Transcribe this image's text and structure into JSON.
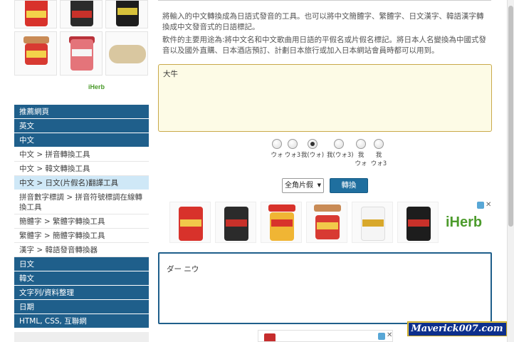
{
  "sidebar": {
    "iherb_label": "iHerb",
    "items": [
      {
        "label": "推薦網頁",
        "style": "dark"
      },
      {
        "label": "英文",
        "style": "dark"
      },
      {
        "label": "中文",
        "style": "dark"
      },
      {
        "label": "中文 > 拼音轉換工具",
        "style": "light"
      },
      {
        "label": "中文 > 韓文轉換工具",
        "style": "light"
      },
      {
        "label": "中文 > 日文(片假名)翻譯工具",
        "style": "active"
      },
      {
        "label": "拼音數字標調 > 拼音符號標調在線轉換工具",
        "style": "light"
      },
      {
        "label": "簡體字 > 繁體字轉換工具",
        "style": "light"
      },
      {
        "label": "繁體字 > 簡體字轉換工具",
        "style": "light"
      },
      {
        "label": "漢字 > 韓語發音轉換器",
        "style": "light"
      },
      {
        "label": "日文",
        "style": "dark"
      },
      {
        "label": "韓文",
        "style": "dark"
      },
      {
        "label": "文字列/資料整理",
        "style": "dark"
      },
      {
        "label": "日期",
        "style": "dark"
      },
      {
        "label": "HTML, CSS, 互聯網",
        "style": "dark"
      }
    ]
  },
  "intro": {
    "p1": "將輸入的中文轉換成為日語式發音的工具。也可以將中文簡體字、繁體字、日文漢字、韓語漢字轉換成中文發音式的日語標記。",
    "p2": "軟件的主要用途為:將中文名和中文歌曲用日語的平假名或片假名標記。將日本人名變換為中國式發音以及國外直購、日本酒店預訂、計劃日本旅行或加入日本網站會員時都可以用到。"
  },
  "input": {
    "value": "大牛"
  },
  "radios": [
    {
      "label": "ウォ",
      "checked": false
    },
    {
      "label": "ウォ3",
      "checked": false
    },
    {
      "label": "我(ウォ)",
      "checked": true
    },
    {
      "label": "我(ウォ3)",
      "checked": false
    },
    {
      "label": "我\nウォ",
      "checked": false
    },
    {
      "label": "我\nウォ3",
      "checked": false
    }
  ],
  "controls": {
    "select_value": "全角片假",
    "convert_label": "轉換"
  },
  "ad": {
    "iherb_label": "iHerb",
    "info_icon": "info-icon",
    "close_label": "✕"
  },
  "output": {
    "value": "ダー ニウ"
  },
  "watermark": {
    "text": "Maverick007.com"
  },
  "colors": {
    "nav_dark": "#1f5f8b",
    "nav_active": "#cfe8f7",
    "input_bg": "#fdfbe6",
    "button": "#1f6f9f"
  }
}
